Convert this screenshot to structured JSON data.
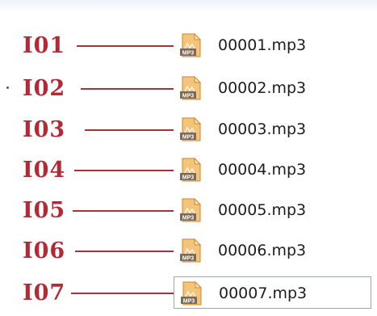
{
  "rows": [
    {
      "tag": "I01",
      "file": "00001.mp3"
    },
    {
      "tag": "I02",
      "file": "00002.mp3"
    },
    {
      "tag": "I03",
      "file": "00003.mp3"
    },
    {
      "tag": "I04",
      "file": "00004.mp3"
    },
    {
      "tag": "I05",
      "file": "00005.mp3"
    },
    {
      "tag": "I06",
      "file": "00006.mp3"
    },
    {
      "tag": "I07",
      "file": "00007.mp3"
    }
  ],
  "icon": {
    "name": "mp3-file-icon",
    "badge": "MP3"
  },
  "colors": {
    "tag": "#b22a35",
    "connector": "#a8323c",
    "filename": "#1d1d1d",
    "icon_body": "#e6ad57",
    "badge": "#7a6a58"
  }
}
